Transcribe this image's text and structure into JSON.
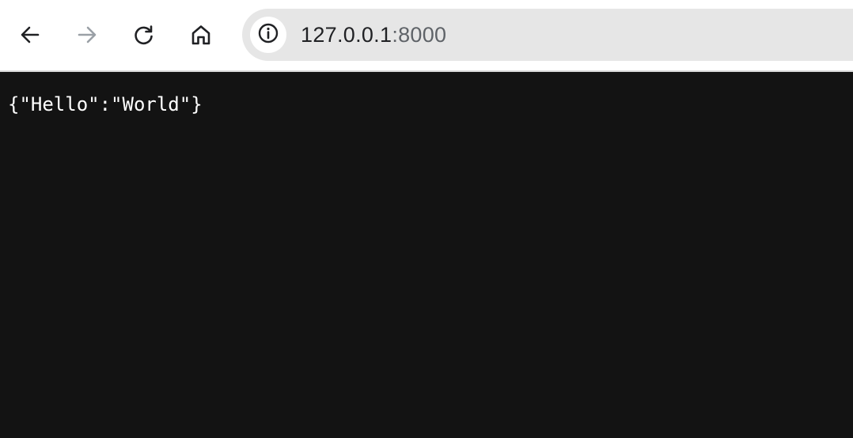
{
  "browser": {
    "nav": {
      "back_icon": "arrow-left-icon",
      "forward_icon": "arrow-right-icon",
      "reload_icon": "reload-icon",
      "home_icon": "home-icon"
    },
    "address_bar": {
      "site_info_icon": "info-icon",
      "host": "127.0.0.1",
      "port": ":8000"
    },
    "colors": {
      "toolbar_bg": "#ffffff",
      "omnibox_bg": "#e6e6e6",
      "page_bg": "#131313",
      "icon_active": "#202124",
      "icon_disabled": "#9aa0a6"
    }
  },
  "page": {
    "body_text": "{\"Hello\":\"World\"}"
  }
}
